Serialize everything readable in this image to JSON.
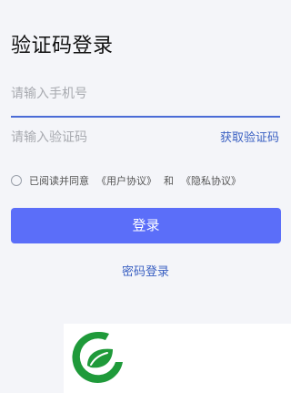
{
  "page": {
    "title": "验证码登录"
  },
  "form": {
    "phone_placeholder": "请输入手机号",
    "phone_value": "",
    "code_placeholder": "请输入验证码",
    "code_value": "",
    "get_code_label": "获取验证码"
  },
  "agreement": {
    "checked": false,
    "prefix": "已阅读并同意",
    "user_agreement": "《用户协议》",
    "conjunction": "和",
    "privacy_agreement": "《隐私协议》"
  },
  "actions": {
    "login_label": "登录",
    "password_login_label": "密码登录"
  },
  "colors": {
    "accent": "#5b6ef9",
    "link": "#3a60c2",
    "logo_green": "#1f9a3a"
  },
  "icons": {
    "logo": "green-leaf-g-logo-icon",
    "radio": "radio-unchecked-icon"
  }
}
